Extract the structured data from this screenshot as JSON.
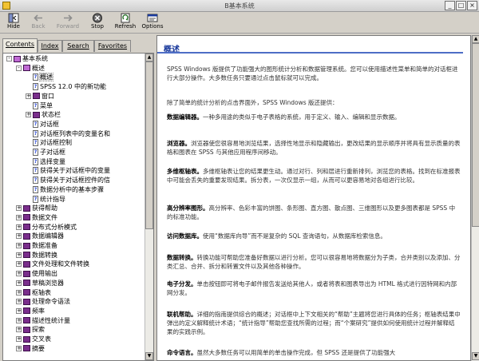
{
  "window": {
    "title": "B基本系统"
  },
  "toolbar": {
    "hide": "Hide",
    "back": "Back",
    "forward": "Forward",
    "stop": "Stop",
    "refresh": "Refresh",
    "options": "Options"
  },
  "tabs": [
    "Contents",
    "Index",
    "Search",
    "Favorites"
  ],
  "tree": [
    {
      "indent": 0,
      "kind": "book-open",
      "toggle": "-",
      "label": "基本系统"
    },
    {
      "indent": 1,
      "kind": "book-open",
      "toggle": "-",
      "label": "概述"
    },
    {
      "indent": 2,
      "kind": "page",
      "label": "概述",
      "selected": true
    },
    {
      "indent": 2,
      "kind": "page",
      "label": "SPSS 12.0 中的新功能"
    },
    {
      "indent": 2,
      "kind": "book",
      "toggle": "+",
      "label": "窗口"
    },
    {
      "indent": 2,
      "kind": "page",
      "label": "菜单"
    },
    {
      "indent": 2,
      "kind": "book",
      "toggle": "+",
      "label": "状态栏"
    },
    {
      "indent": 2,
      "kind": "page",
      "label": "对话框"
    },
    {
      "indent": 2,
      "kind": "page",
      "label": "对话框列表中的变量名和"
    },
    {
      "indent": 2,
      "kind": "page",
      "label": "对话框控制"
    },
    {
      "indent": 2,
      "kind": "page",
      "label": "子对话框"
    },
    {
      "indent": 2,
      "kind": "page",
      "label": "选择变量"
    },
    {
      "indent": 2,
      "kind": "page",
      "label": "获得关于对话框中的变量"
    },
    {
      "indent": 2,
      "kind": "page",
      "label": "获得关于对话框控件的信"
    },
    {
      "indent": 2,
      "kind": "page",
      "label": "数据分析中的基本步骤"
    },
    {
      "indent": 2,
      "kind": "page",
      "label": "统计指导"
    },
    {
      "indent": 1,
      "kind": "book",
      "toggle": "+",
      "label": "获得帮助"
    },
    {
      "indent": 1,
      "kind": "book",
      "toggle": "+",
      "label": "数据文件"
    },
    {
      "indent": 1,
      "kind": "book",
      "toggle": "+",
      "label": "分布式分析模式"
    },
    {
      "indent": 1,
      "kind": "book",
      "toggle": "+",
      "label": "数据编辑器"
    },
    {
      "indent": 1,
      "kind": "book",
      "toggle": "+",
      "label": "数据准备"
    },
    {
      "indent": 1,
      "kind": "book",
      "toggle": "+",
      "label": "数据转换"
    },
    {
      "indent": 1,
      "kind": "book",
      "toggle": "+",
      "label": "文件处理和文件转换"
    },
    {
      "indent": 1,
      "kind": "book",
      "toggle": "+",
      "label": "使用输出"
    },
    {
      "indent": 1,
      "kind": "book",
      "toggle": "+",
      "label": "草稿浏览器"
    },
    {
      "indent": 1,
      "kind": "book",
      "toggle": "+",
      "label": "枢轴表"
    },
    {
      "indent": 1,
      "kind": "book",
      "toggle": "+",
      "label": "处理命令语法"
    },
    {
      "indent": 1,
      "kind": "book",
      "toggle": "+",
      "label": "频率"
    },
    {
      "indent": 1,
      "kind": "book",
      "toggle": "+",
      "label": "描述性统计量"
    },
    {
      "indent": 1,
      "kind": "book",
      "toggle": "+",
      "label": "探索"
    },
    {
      "indent": 1,
      "kind": "book",
      "toggle": "+",
      "label": "交叉表"
    },
    {
      "indent": 1,
      "kind": "book",
      "toggle": "+",
      "label": "摘要"
    }
  ],
  "content": {
    "heading": "概述",
    "paragraphs": [
      {
        "bold": "",
        "text": "SPSS Windows 版提供了功能强大的图形统计分析和数据管理系统。您可以使用描述性菜单和简单的对话框进行大部分操作。大多数任务只要通过点击鼠标就可以完成。"
      },
      {
        "bold": "",
        "text": "除了简单的统计分析的点击界面外，SPSS Windows 版还提供："
      },
      {
        "bold": "数据编辑器。",
        "text": "一种多用途的类似于电子表格的系统，用于定义、输入、编辑和显示数据。"
      },
      {
        "bold": "浏览器。",
        "text": "浏览器使您很容易地浏览结果，选择性地显示和隐藏输出，更改结果的显示顺序并将具有显示质量的表格和图表在 SPSS 与其他应用程序间移动。"
      },
      {
        "bold": "多维枢轴表。",
        "text": "多维枢轴表让您的结果更生动。通过对行、列和层进行重新排列，浏览您的表格。找到在标准报表中可能会丢失的重要发现结果。拆分表，一次仅显示一组，从而可以更容易地对各组进行比较。"
      },
      {
        "bold": "高分辨率图形。",
        "text": "高分辨率、色彩丰富的饼图、条形图、直方图、散点图、三维图形以及更多图表都是 SPSS 中的标准功能。"
      },
      {
        "bold": "访问数据库。",
        "text": "使用“数据库向导”而不是复杂的 SQL 查询语句，从数据库检索信息。"
      },
      {
        "bold": "数据转换。",
        "text": "转换功能可帮助您准备好数据以进行分析。您可以很容易地将数据分为子类，合并类别以及添加、分类汇总、合并、拆分和转置文件以及其他各种操作。"
      },
      {
        "bold": "电子分发。",
        "text": "单击按钮即可将电子邮件报告发送给其他人，或者将表和图表导出为 HTML 格式进行因特网和内部网分发。"
      },
      {
        "bold": "联机帮助。",
        "text": "详细的指南提供综合的概述；对话框中上下文相关的“帮助”主题将您进行具体的任务；枢轴表结果中弹出的定义解释统计术语；“统计指导”帮助您查找所需的过程；而“个案研究”提供如何使用统计过程并解释结果的实践示例。"
      },
      {
        "bold": "命令语言。",
        "text": "虽然大多数任务可以用简单的单击操作完成，但 SPSS 还是提供了功能强大"
      }
    ]
  },
  "colors": {
    "heading": "#1a3a9c",
    "rule": "#4e6ec6",
    "book": "#7a2e8c"
  }
}
